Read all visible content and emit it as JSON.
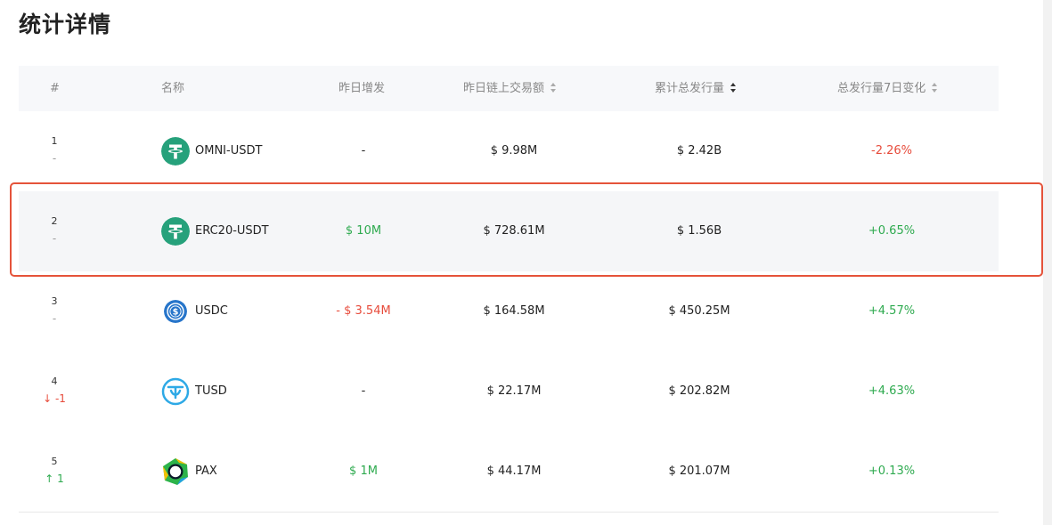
{
  "page": {
    "title": "统计详情"
  },
  "table": {
    "headers": {
      "rank": "#",
      "name": "名称",
      "yesterday_issue": "昨日增发",
      "yesterday_volume": "昨日链上交易额",
      "total_supply": "累计总发行量",
      "change_7d": "总发行量7日变化"
    },
    "rows": [
      {
        "rank": "1",
        "rank_change": "-",
        "rank_change_dir": "none",
        "name": "OMNI-USDT",
        "icon": "tether-icon",
        "yesterday_issue": "-",
        "yesterday_issue_color": "neutral",
        "yesterday_volume": "$ 9.98M",
        "total_supply": "$ 2.42B",
        "change_7d": "-2.26%",
        "change_7d_color": "red"
      },
      {
        "rank": "2",
        "rank_change": "-",
        "rank_change_dir": "none",
        "name": "ERC20-USDT",
        "icon": "tether-icon",
        "yesterday_issue": "$ 10M",
        "yesterday_issue_color": "green",
        "yesterday_volume": "$ 728.61M",
        "total_supply": "$ 1.56B",
        "change_7d": "+0.65%",
        "change_7d_color": "green"
      },
      {
        "rank": "3",
        "rank_change": "-",
        "rank_change_dir": "none",
        "name": "USDC",
        "icon": "usdc-icon",
        "yesterday_issue": "- $ 3.54M",
        "yesterday_issue_color": "red",
        "yesterday_volume": "$ 164.58M",
        "total_supply": "$ 450.25M",
        "change_7d": "+4.57%",
        "change_7d_color": "green"
      },
      {
        "rank": "4",
        "rank_change": "↓ -1",
        "rank_change_dir": "down",
        "name": "TUSD",
        "icon": "tusd-icon",
        "yesterday_issue": "-",
        "yesterday_issue_color": "neutral",
        "yesterday_volume": "$ 22.17M",
        "total_supply": "$ 202.82M",
        "change_7d": "+4.63%",
        "change_7d_color": "green"
      },
      {
        "rank": "5",
        "rank_change": "↑ 1",
        "rank_change_dir": "up",
        "name": "PAX",
        "icon": "pax-icon",
        "yesterday_issue": "$ 1M",
        "yesterday_issue_color": "green",
        "yesterday_volume": "$ 44.17M",
        "total_supply": "$ 201.07M",
        "change_7d": "+0.13%",
        "change_7d_color": "green"
      }
    ],
    "highlighted_row": 2
  },
  "colors": {
    "positive": "#2eaa4f",
    "negative": "#e74c3c",
    "tether": "#26a17b",
    "usdc": "#2775ca",
    "tusd": "#1a5aff",
    "highlight_border": "#e5533a"
  }
}
